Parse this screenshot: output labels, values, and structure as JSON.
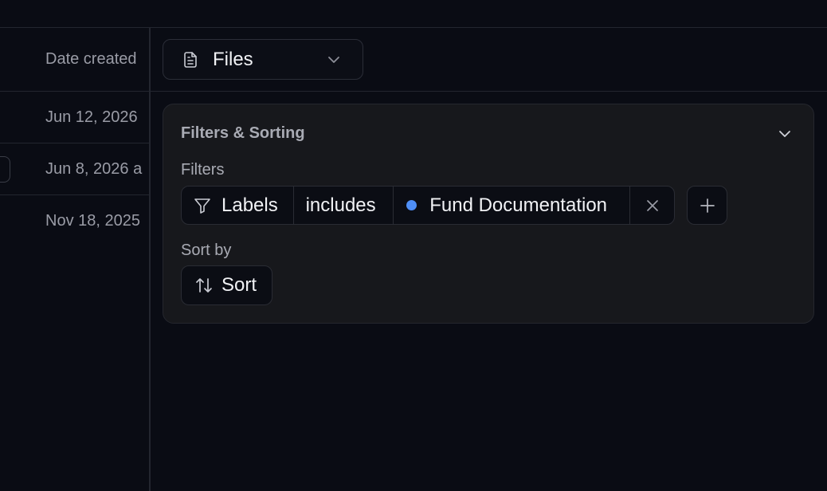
{
  "table": {
    "date_header": "Date created",
    "rows": [
      {
        "date": "Jun 12, 2026"
      },
      {
        "date": "Jun 8, 2026 a"
      },
      {
        "date": "Nov 18, 2025"
      }
    ]
  },
  "view_select": {
    "label": "Files",
    "icon": "document-icon"
  },
  "filters_panel": {
    "title": "Filters & Sorting",
    "filters_label": "Filters",
    "filter": {
      "field": "Labels",
      "operator": "includes",
      "value": "Fund Documentation",
      "value_color": "#4f8ff7"
    },
    "sort_label": "Sort by",
    "sort_button": "Sort"
  },
  "colors": {
    "background": "#0a0c14",
    "card": "#17181c",
    "accent": "#4f8ff7"
  }
}
